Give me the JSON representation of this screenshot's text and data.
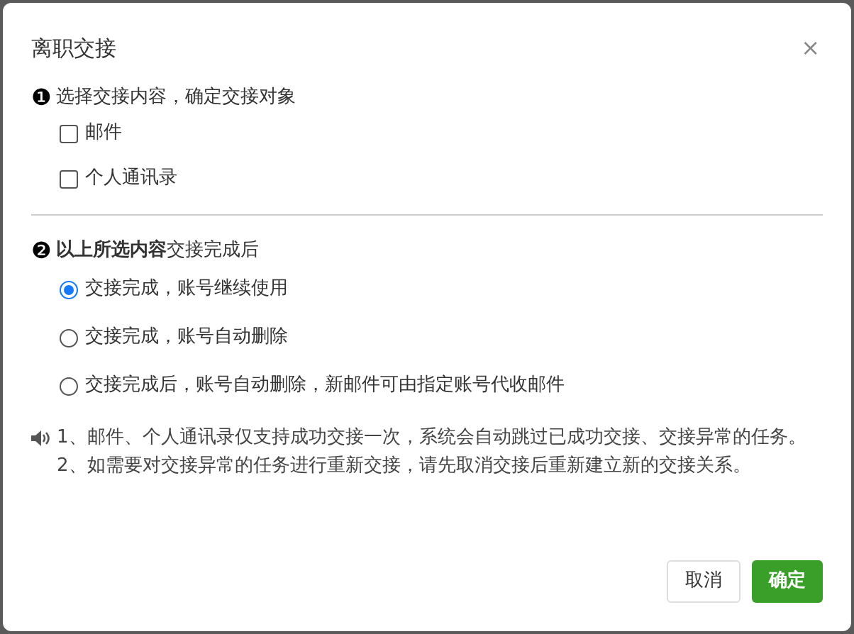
{
  "dialog": {
    "title": "离职交接",
    "close": "×"
  },
  "step_1": {
    "marker": "❶",
    "label": "选择交接内容，确定交接对象",
    "options": [
      {
        "label": "邮件",
        "checked": false
      },
      {
        "label": "个人通讯录",
        "checked": false
      }
    ]
  },
  "step_2": {
    "marker": "❷",
    "label": "**以上所选内容**交接完成后",
    "options": [
      {
        "label": "交接完成，账号继续使用",
        "selected": true
      },
      {
        "label": "交接完成，账号自动删除",
        "selected": false
      },
      {
        "label": "交接完成后，账号自动删除，新邮件可由指定账号代收邮件",
        "selected": false
      }
    ]
  },
  "notes": [
    "1、邮件、个人通讯录仅支持成功交接一次，系统会自动跳过已成功交接、交接异常的任务。",
    "2、如需要对交接异常的任务进行重新交接，请先取消交接后重新建立新的交接关系。"
  ],
  "buttons": [
    {
      "label": "取消",
      "kind": "secondary"
    },
    {
      "label": "确定",
      "kind": "primary"
    }
  ]
}
